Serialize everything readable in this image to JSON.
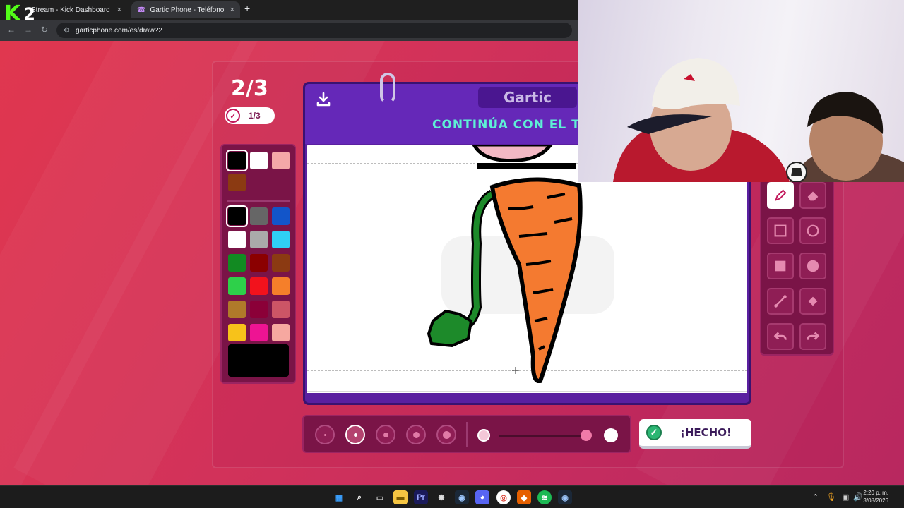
{
  "browser": {
    "tabs": [
      {
        "title": "Stream - Kick Dashboard",
        "close": "×"
      },
      {
        "title": "Gartic Phone - Teléfono Descon",
        "close": "×"
      }
    ],
    "new_tab": "+",
    "url": "garticphone.com/es/draw?2",
    "overlay_logo": {
      "mark": "K",
      "number": "2"
    }
  },
  "game": {
    "round": "2/3",
    "progress": "1/3",
    "logo": "Gartic",
    "instruction": "CONTINÚA CON EL T",
    "done_label": "¡HECHO!",
    "palette": {
      "top": [
        "#000000",
        "#ffffff",
        "#f4a8a8",
        "#8b3a12"
      ],
      "grid": [
        "#000000",
        "#666666",
        "#1255c9",
        "#ffffff",
        "#aaaaaa",
        "#2fd0f5",
        "#128a22",
        "#8b0000",
        "#8b3a12",
        "#2ed04a",
        "#f2121c",
        "#f57f2a",
        "#b07a2a",
        "#8b0038",
        "#cc5566",
        "#f7c21a",
        "#ee1493",
        "#f6a8a0"
      ],
      "selected_color": "#000000"
    },
    "tools": [
      {
        "name": "pencil-tool",
        "selected": true
      },
      {
        "name": "eraser-tool",
        "selected": false
      },
      {
        "name": "rectangle-outline-tool",
        "selected": false
      },
      {
        "name": "ellipse-outline-tool",
        "selected": false
      },
      {
        "name": "rectangle-fill-tool",
        "selected": false
      },
      {
        "name": "ellipse-fill-tool",
        "selected": false
      },
      {
        "name": "line-tool",
        "selected": false
      },
      {
        "name": "fill-bucket-tool",
        "selected": false
      },
      {
        "name": "undo-tool",
        "selected": false
      },
      {
        "name": "redo-tool",
        "selected": false
      }
    ],
    "brush_sizes": {
      "count": 5,
      "selected_index": 1
    },
    "opacity": 0.95
  },
  "taskbar": {
    "clock_time": "2:20 p. m.",
    "clock_date": "3/08/2026"
  }
}
